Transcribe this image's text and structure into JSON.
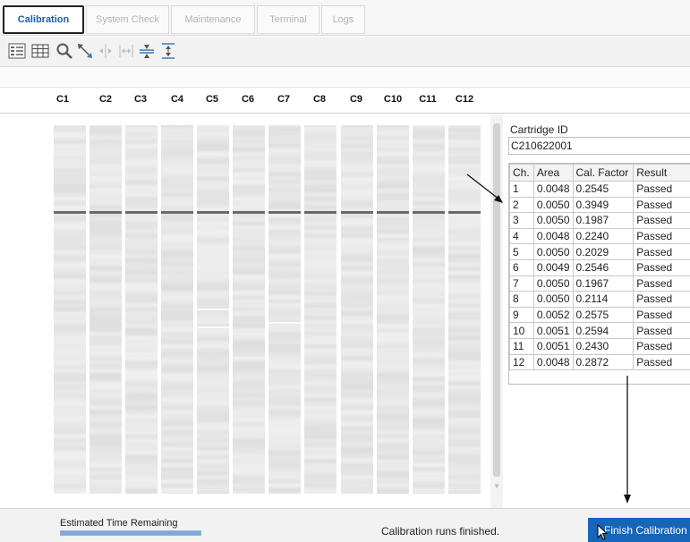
{
  "tabs": [
    {
      "label": "Calibration",
      "active": true
    },
    {
      "label": "System Check",
      "active": false
    },
    {
      "label": "Maintenance",
      "active": false
    },
    {
      "label": "Terminal",
      "active": false
    },
    {
      "label": "Logs",
      "active": false
    }
  ],
  "toolbar": {
    "icons": [
      "lane-view-icon",
      "grid-view-icon",
      "zoom-icon",
      "fit-view-icon",
      "align-peaks-icon",
      "expand-width-icon",
      "split-horizontal-icon",
      "expand-height-icon"
    ]
  },
  "columns": [
    "C1",
    "C2",
    "C3",
    "C4",
    "C5",
    "C6",
    "C7",
    "C8",
    "C9",
    "C10",
    "C11",
    "C12"
  ],
  "cartridge": {
    "label": "Cartridge ID",
    "value": "C210622001"
  },
  "results_table": {
    "headers": [
      "Ch.",
      "Area",
      "Cal. Factor",
      "Result"
    ],
    "rows": [
      [
        "1",
        "0.0048",
        "0.2545",
        "Passed"
      ],
      [
        "2",
        "0.0050",
        "0.3949",
        "Passed"
      ],
      [
        "3",
        "0.0050",
        "0.1987",
        "Passed"
      ],
      [
        "4",
        "0.0048",
        "0.2240",
        "Passed"
      ],
      [
        "5",
        "0.0050",
        "0.2029",
        "Passed"
      ],
      [
        "6",
        "0.0049",
        "0.2546",
        "Passed"
      ],
      [
        "7",
        "0.0050",
        "0.1967",
        "Passed"
      ],
      [
        "8",
        "0.0050",
        "0.2114",
        "Passed"
      ],
      [
        "9",
        "0.0052",
        "0.2575",
        "Passed"
      ],
      [
        "10",
        "0.0051",
        "0.2594",
        "Passed"
      ],
      [
        "11",
        "0.0051",
        "0.2430",
        "Passed"
      ],
      [
        "12",
        "0.0048",
        "0.2872",
        "Passed"
      ]
    ]
  },
  "status": {
    "etr_label": "Estimated Time Remaining",
    "etr_progress": 1.0,
    "message": "Calibration runs finished.",
    "finish_button": "Finish Calibration"
  },
  "colors": {
    "accent": "#1565b8",
    "active_tab_text": "#1d5fa8",
    "lane_base": "#e6e6e6",
    "band": "#6a6a6a"
  }
}
